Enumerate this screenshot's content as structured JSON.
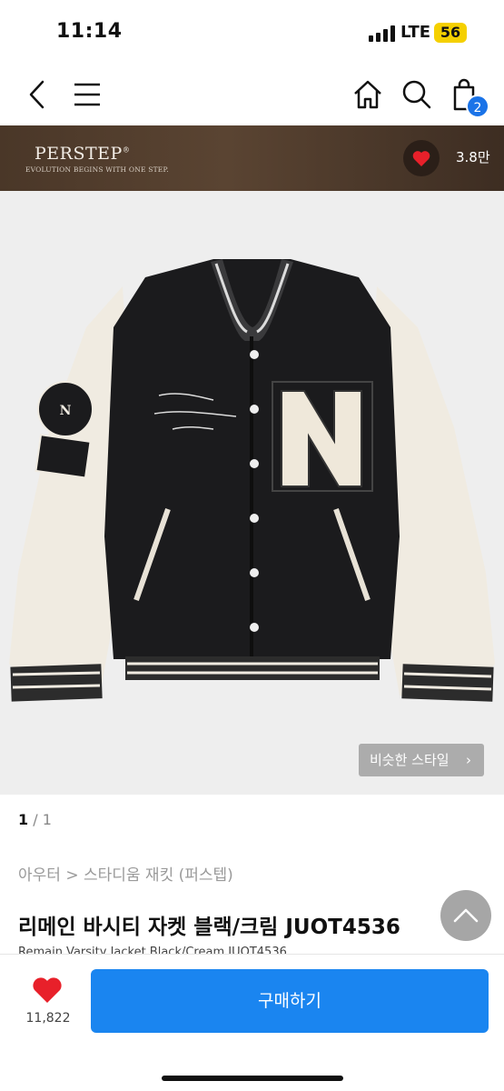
{
  "status_bar": {
    "time": "11:14",
    "network": "LTE",
    "battery": "56"
  },
  "nav": {
    "back_icon": "chevron-left-icon",
    "menu_icon": "hamburger-icon",
    "home_icon": "home-icon",
    "search_icon": "search-icon",
    "cart_icon": "shopping-bag-icon",
    "cart_count": "2"
  },
  "brand": {
    "name": "PERSTEP",
    "registered_mark": "®",
    "slogan": "EVOLUTION BEGINS WITH ONE STEP.",
    "like_icon": "heart-icon",
    "like_count": "3.8만",
    "background_color": "#4a3728"
  },
  "gallery": {
    "image_description_icon": "product-photo",
    "similar_style_label": "비슷한 스타일",
    "current_page": "1",
    "separator": "/",
    "total_pages": "1"
  },
  "product": {
    "breadcrumb": "아우터 > 스타디움 재킷 (퍼스텝)",
    "title": "리메인 바시티 자켓 블랙/크림 JUOT4536",
    "subtitle": "Remain Varsity Jacket Black/Cream JUOT4536"
  },
  "bottom_bar": {
    "wish_icon": "heart-icon",
    "wish_count": "11,822",
    "buy_label": "구매하기",
    "buy_color": "#1a85f0",
    "heart_color": "#e8202a"
  }
}
